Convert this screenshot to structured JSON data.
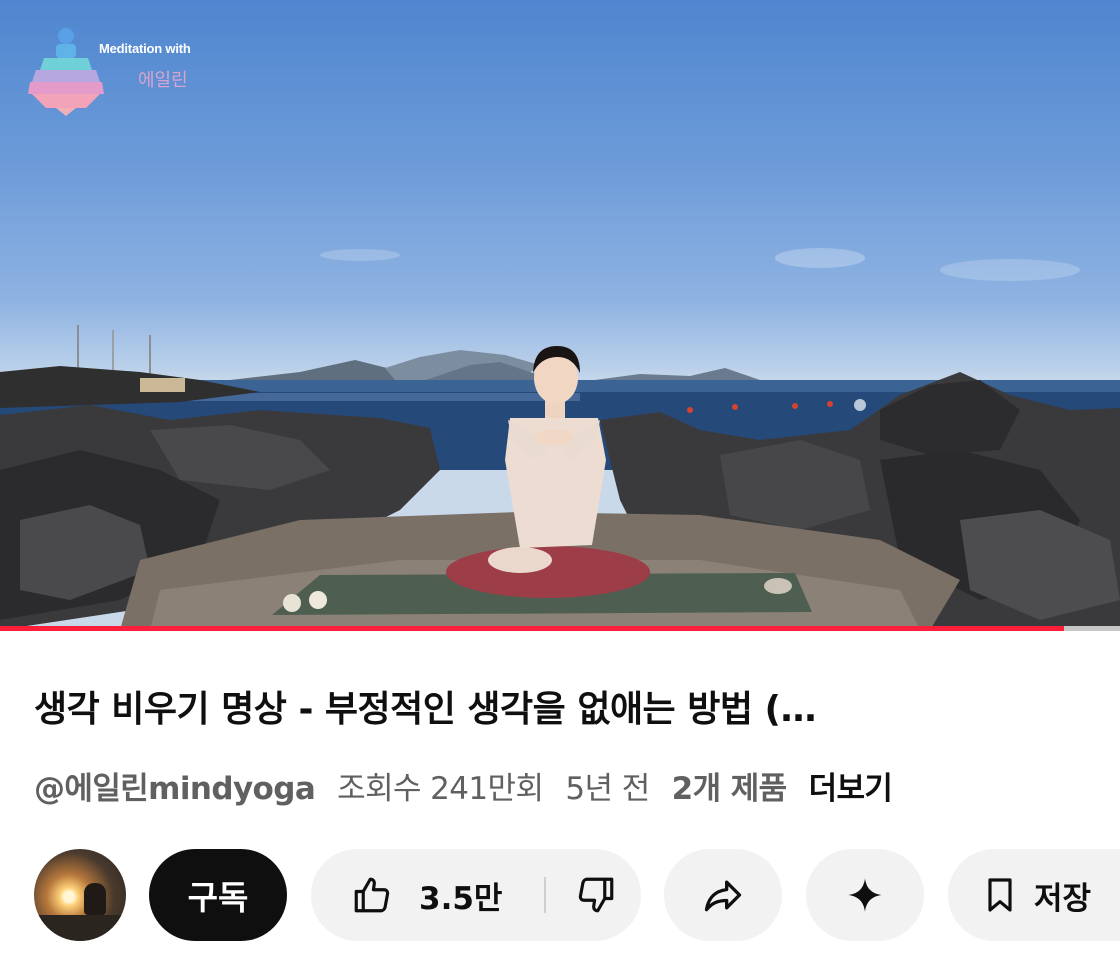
{
  "video": {
    "logo": {
      "line1": "Meditation with",
      "line2": "에일린"
    },
    "progress_fraction": 0.95
  },
  "info": {
    "title": "생각 비우기 명상 - 부정적인 생각을 없애는 방법 (…",
    "channel": "@에일린mindyoga",
    "views": "조회수 241만회",
    "age": "5년 전",
    "products": "2개 제품",
    "more": "더보기"
  },
  "actions": {
    "subscribe_label": "구독",
    "like_count": "3.5만",
    "save_label": "저장",
    "icons": [
      "thumbs-up-icon",
      "thumbs-down-icon",
      "share-icon",
      "sparkle-icon",
      "bookmark-icon"
    ]
  },
  "colors": {
    "progress": "#ff1f3a",
    "subscribe_bg": "#0f0f0f",
    "pill_bg": "#f2f2f2",
    "meta_text": "#606060"
  }
}
